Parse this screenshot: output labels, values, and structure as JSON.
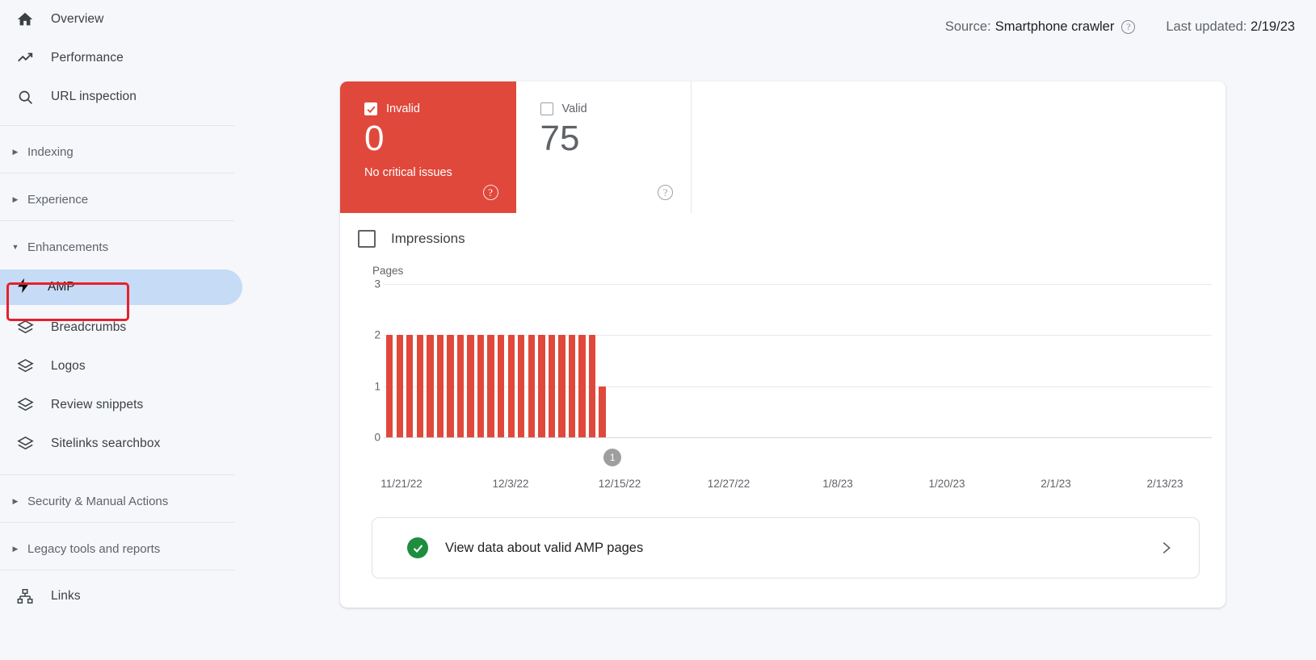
{
  "header": {
    "source_label": "Source:",
    "source_value": "Smartphone crawler",
    "help_icon": "help-circle-icon",
    "last_updated_label": "Last updated:",
    "last_updated_value": "2/19/23"
  },
  "sidebar": {
    "top_items": [
      {
        "label": "Overview",
        "icon": "home-icon"
      },
      {
        "label": "Performance",
        "icon": "trending-up-icon"
      },
      {
        "label": "URL inspection",
        "icon": "search-icon"
      }
    ],
    "groups": [
      {
        "label": "Indexing",
        "expanded": false,
        "icon": "caret-right-icon"
      },
      {
        "label": "Experience",
        "expanded": false,
        "icon": "caret-right-icon"
      },
      {
        "label": "Enhancements",
        "expanded": true,
        "icon": "caret-down-icon"
      }
    ],
    "enhancement_items": [
      {
        "label": "AMP",
        "icon": "bolt-icon",
        "selected": true
      },
      {
        "label": "Breadcrumbs",
        "icon": "layers-icon",
        "selected": false
      },
      {
        "label": "Logos",
        "icon": "layers-icon",
        "selected": false
      },
      {
        "label": "Review snippets",
        "icon": "layers-icon",
        "selected": false
      },
      {
        "label": "Sitelinks searchbox",
        "icon": "layers-icon",
        "selected": false
      }
    ],
    "bottom_groups": [
      {
        "label": "Security & Manual Actions",
        "icon": "caret-right-icon"
      },
      {
        "label": "Legacy tools and reports",
        "icon": "caret-right-icon"
      }
    ],
    "links_item": {
      "label": "Links",
      "icon": "sitemap-icon"
    }
  },
  "tiles": [
    {
      "name": "Invalid",
      "value": "0",
      "subtitle": "No critical issues",
      "checked": true,
      "color": "#e0483b",
      "help_icon": "help-circle-icon"
    },
    {
      "name": "Valid",
      "value": "75",
      "subtitle": "",
      "checked": false,
      "color": "#ffffff",
      "help_icon": "help-circle-icon"
    }
  ],
  "impressions": {
    "label": "Impressions",
    "checked": false
  },
  "footer_link": {
    "label": "View data about valid AMP pages",
    "status_icon": "check-circle-icon",
    "status_color": "#1e8e3e",
    "chevron_icon": "chevron-right-icon"
  },
  "chart_data": {
    "type": "bar",
    "title": "",
    "ylabel": "Pages",
    "xlabel": "",
    "ylim": [
      0,
      3
    ],
    "yticks": [
      0,
      1,
      2,
      3
    ],
    "grid": true,
    "legend": "none",
    "bar_color": "#e0483b",
    "xticks": [
      "11/21/22",
      "12/3/22",
      "12/15/22",
      "12/27/22",
      "1/8/23",
      "1/20/23",
      "2/1/23",
      "2/13/23"
    ],
    "x_range": [
      "11/19/22",
      "2/19/23"
    ],
    "series": [
      {
        "name": "Invalid",
        "values": [
          2,
          2,
          2,
          2,
          2,
          2,
          2,
          2,
          2,
          2,
          2,
          2,
          2,
          2,
          2,
          2,
          2,
          2,
          2,
          2,
          2,
          1
        ]
      }
    ],
    "annotations": [
      {
        "text": "1",
        "position": "below-axis-end",
        "color": "#9e9e9e"
      }
    ]
  }
}
